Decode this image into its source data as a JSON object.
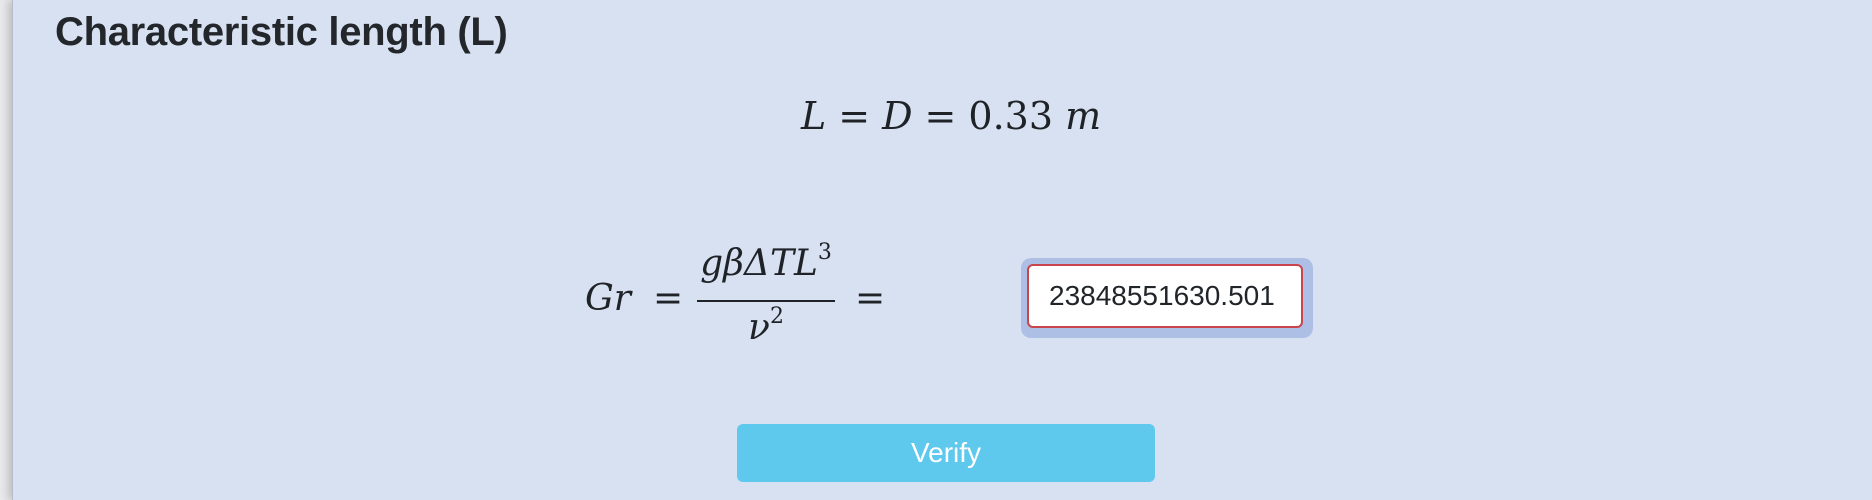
{
  "section": {
    "title": "Characteristic length (L)"
  },
  "length_equation": {
    "lhs1": "L",
    "eq": "=",
    "lhs2": "D",
    "value": "0.33",
    "unit": "m"
  },
  "grashof_equation": {
    "symbol": "Gr",
    "eq": "=",
    "numerator": "gβΔTL",
    "numerator_exp": "3",
    "denominator": "ν",
    "denominator_exp": "2"
  },
  "answer": {
    "value": "23848551630.501"
  },
  "buttons": {
    "verify_label": "Verify"
  },
  "colors": {
    "panel_background": "#d7e1f1",
    "verify_button": "#5fc8ed",
    "input_error_border": "#c9444b",
    "input_focus_ring": "#aebfe6"
  }
}
